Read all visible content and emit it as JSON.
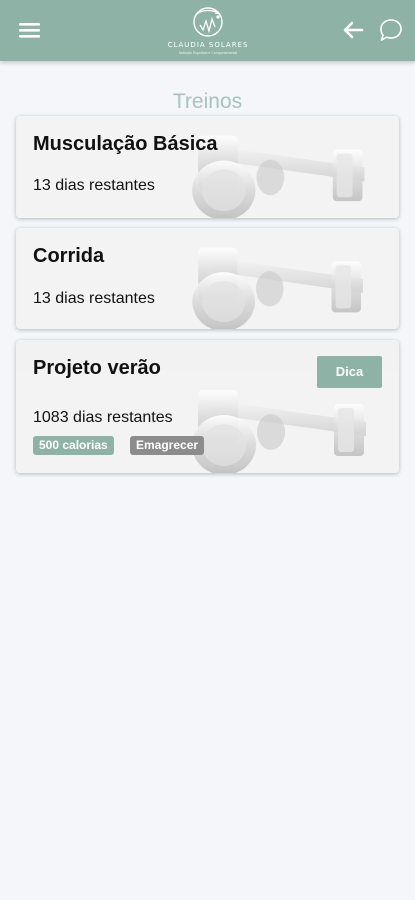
{
  "app": {
    "logo_name": "CLAUDIA SOLARES",
    "logo_tagline": "Nutrição Esportiva e Comportamental"
  },
  "page": {
    "title": "Treinos"
  },
  "workouts": [
    {
      "title": "Musculação Básica",
      "days_left": "13 dias restantes"
    },
    {
      "title": "Corrida",
      "days_left": "13 dias restantes"
    },
    {
      "title": "Projeto verão",
      "days_left": "1083 dias restantes",
      "tip_label": "Dica",
      "tags": [
        "500 calorias",
        "Emagrecer"
      ]
    }
  ],
  "icons": {
    "menu": "menu-icon",
    "back": "arrow-left-icon",
    "chat": "chat-bubble-icon",
    "card_background": "dumbbell-icon"
  },
  "colors": {
    "primary": "#8fb2a6",
    "title_text": "#a9c3bb",
    "tag_gray": "#8c8c8c",
    "background": "#f4f6f9"
  }
}
